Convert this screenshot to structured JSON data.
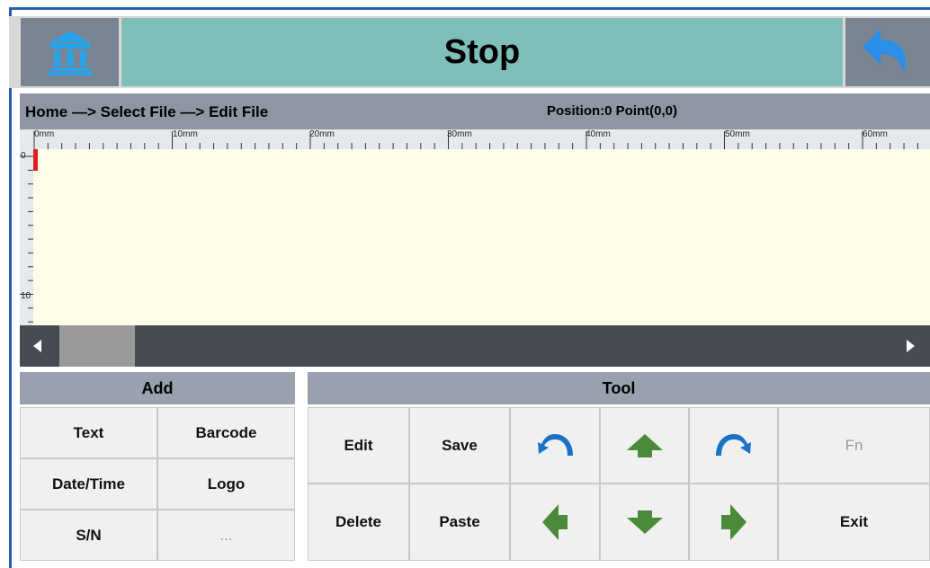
{
  "header": {
    "title": "Stop",
    "home_icon": "bank-icon",
    "back_icon": "undo-arrow-icon",
    "title_bg": "#7fbfb9"
  },
  "breadcrumb": {
    "text": "Home —> Select File —> Edit File",
    "position": "Position:0 Point(0,0)"
  },
  "ruler": {
    "h_labels": [
      "0mm",
      "10mm",
      "20mm",
      "30mm",
      "40mm",
      "50mm",
      "60mm"
    ],
    "v_labels": [
      "0",
      "10"
    ]
  },
  "add_panel": {
    "title": "Add",
    "buttons": [
      "Text",
      "Barcode",
      "Date/Time",
      "Logo",
      "S/N",
      "..."
    ]
  },
  "tool_panel": {
    "title": "Tool",
    "edit": "Edit",
    "save": "Save",
    "delete": "Delete",
    "paste": "Paste",
    "fn": "Fn",
    "exit": "Exit",
    "icons": {
      "rotate_left": "rotate-left-icon",
      "up": "arrow-up-icon",
      "rotate_right": "rotate-right-icon",
      "left": "arrow-left-icon",
      "down": "arrow-down-icon",
      "right": "arrow-right-icon"
    },
    "arrow_color": "#4a8a3a",
    "rotate_color": "#1a72c8"
  }
}
